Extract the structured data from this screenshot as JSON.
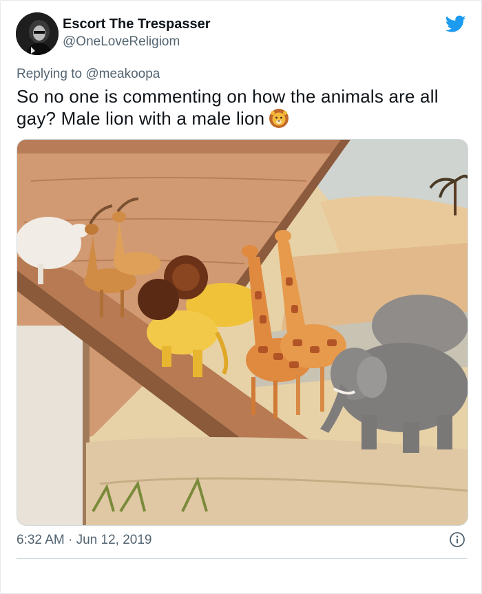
{
  "tweet": {
    "display_name": "Escort The Trespasser",
    "handle": "@OneLoveReligiom",
    "reply_prefix": "Replying to",
    "reply_to": "@meakoopa",
    "text": "So no one is commenting on how the animals are all gay? Male lion with a male lion",
    "emoji": "lion-face-icon",
    "time": "6:32 AM",
    "separator": "·",
    "date": "Jun 12, 2019"
  },
  "icons": {
    "brand": "twitter-bird-icon",
    "info": "info-icon"
  },
  "colors": {
    "twitter_blue": "#1d9bf0",
    "secondary_text": "#536471",
    "primary_text": "#0f1419"
  }
}
